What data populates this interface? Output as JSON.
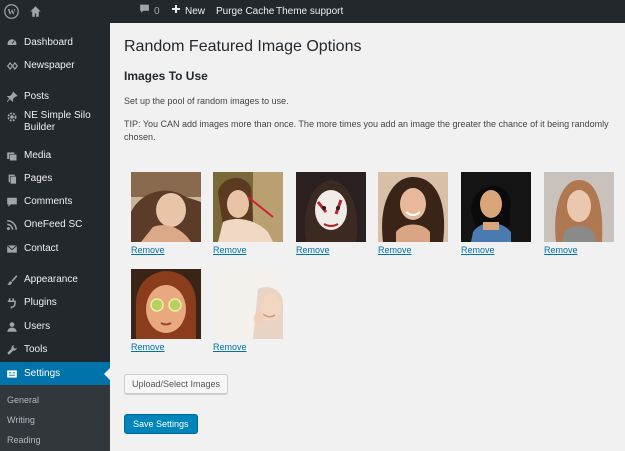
{
  "admin_bar": {
    "comments_count": "0",
    "new_label": "New",
    "purge_label": "Purge Cache",
    "theme_support_label": "Theme support"
  },
  "sidebar": {
    "items": [
      {
        "label": "Dashboard",
        "icon": "dashboard-icon"
      },
      {
        "label": "Newspaper",
        "icon": "newspaper-icon"
      },
      {
        "label": "Posts",
        "icon": "pin-icon"
      },
      {
        "label": "NE Simple Silo Builder",
        "icon": "gear-icon"
      },
      {
        "label": "Media",
        "icon": "media-icon"
      },
      {
        "label": "Pages",
        "icon": "pages-icon"
      },
      {
        "label": "Comments",
        "icon": "comment-icon"
      },
      {
        "label": "OneFeed SC",
        "icon": "rss-icon"
      },
      {
        "label": "Contact",
        "icon": "mail-icon"
      },
      {
        "label": "Appearance",
        "icon": "brush-icon"
      },
      {
        "label": "Plugins",
        "icon": "plugin-icon"
      },
      {
        "label": "Users",
        "icon": "user-icon"
      },
      {
        "label": "Tools",
        "icon": "wrench-icon"
      },
      {
        "label": "Settings",
        "icon": "settings-icon",
        "active": true
      }
    ],
    "submenu": [
      "General",
      "Writing",
      "Reading"
    ]
  },
  "main": {
    "title": "Random Featured Image Options",
    "section_title": "Images To Use",
    "description": "Set up the pool of random images to use.",
    "tip": "TIP: You CAN add images more than once. The more times you add an image the greater the chance of it being randomly chosen.",
    "images": [
      {
        "remove_label": "Remove"
      },
      {
        "remove_label": "Remove"
      },
      {
        "remove_label": "Remove"
      },
      {
        "remove_label": "Remove"
      },
      {
        "remove_label": "Remove"
      },
      {
        "remove_label": "Remove"
      },
      {
        "remove_label": "Remove"
      },
      {
        "remove_label": "Remove"
      }
    ],
    "upload_button": "Upload/Select Images",
    "save_button": "Save Settings"
  },
  "colors": {
    "admin_bg": "#23282d",
    "accent": "#0073aa",
    "primary_button": "#0085ba",
    "page_bg": "#f1f1f1"
  }
}
